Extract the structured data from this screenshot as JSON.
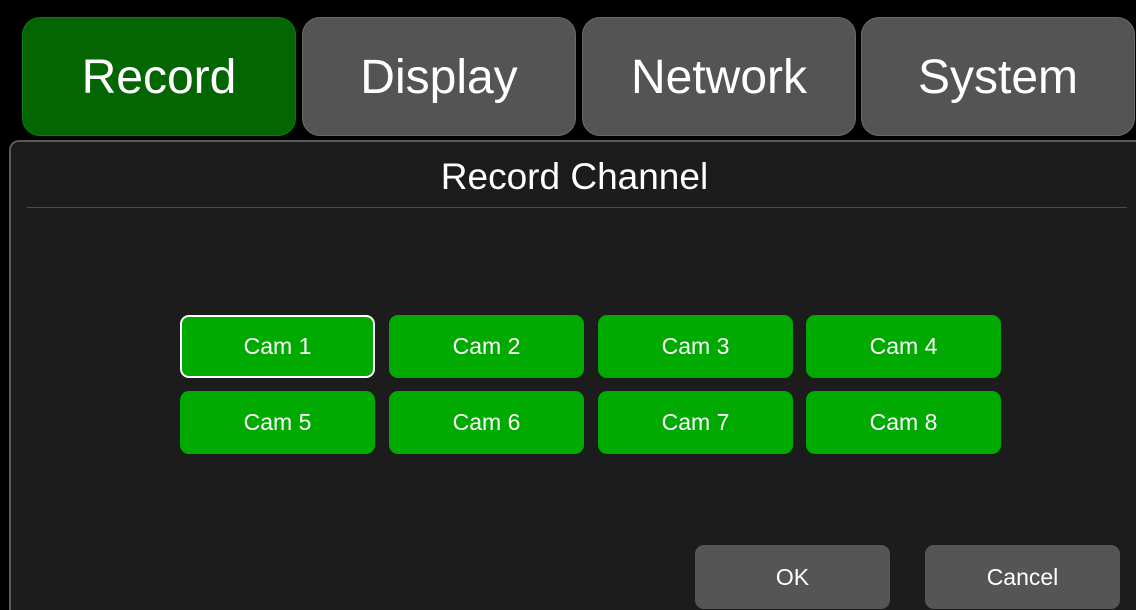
{
  "tabs": [
    {
      "label": "Record",
      "active": true
    },
    {
      "label": "Display",
      "active": false
    },
    {
      "label": "Network",
      "active": false
    },
    {
      "label": "System",
      "active": false
    }
  ],
  "dialog": {
    "title": "Record Channel",
    "selected_channel": "Cam 1",
    "channels": [
      "Cam 1",
      "Cam 2",
      "Cam 3",
      "Cam 4",
      "Cam 5",
      "Cam 6",
      "Cam 7",
      "Cam 8"
    ],
    "ok_label": "OK",
    "cancel_label": "Cancel"
  },
  "colors": {
    "active_tab": "#036603",
    "inactive_tab": "#545454",
    "channel_button": "#00aa00",
    "action_button": "#555555",
    "panel_background": "#1c1c1c"
  }
}
